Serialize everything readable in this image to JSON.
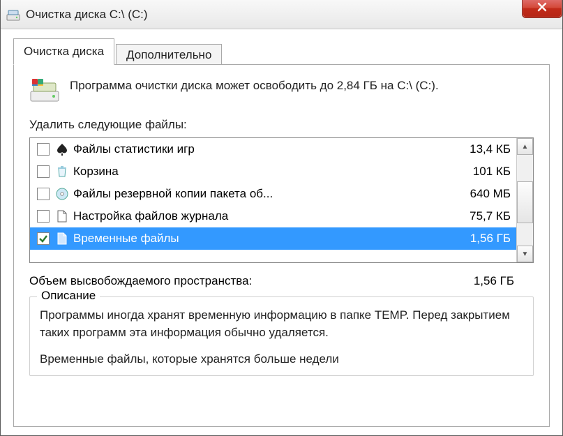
{
  "window": {
    "title": "Очистка диска C:\\ (C:)"
  },
  "tabs": {
    "cleanup": "Очистка диска",
    "more": "Дополнительно"
  },
  "intro": "Программа очистки диска может освободить до 2,84 ГБ на C:\\ (C:).",
  "files_label": "Удалить следующие файлы:",
  "files": [
    {
      "label": "Файлы статистики игр",
      "size": "13,4 КБ",
      "checked": false,
      "selected": false,
      "icon": "spade"
    },
    {
      "label": "Корзина",
      "size": "101 КБ",
      "checked": false,
      "selected": false,
      "icon": "bin"
    },
    {
      "label": "Файлы резервной копии пакета об...",
      "size": "640 МБ",
      "checked": false,
      "selected": false,
      "icon": "disc"
    },
    {
      "label": "Настройка файлов журнала",
      "size": "75,7 КБ",
      "checked": false,
      "selected": false,
      "icon": "page"
    },
    {
      "label": "Временные файлы",
      "size": "1,56 ГБ",
      "checked": true,
      "selected": true,
      "icon": "page"
    }
  ],
  "total": {
    "label": "Объем высвобождаемого пространства:",
    "value": "1,56 ГБ"
  },
  "description": {
    "title": "Описание",
    "body1": "Программы иногда хранят временную информацию в папке TEMP. Перед закрытием таких программ эта информация обычно удаляется.",
    "body2": "Временные файлы, которые хранятся больше недели"
  }
}
